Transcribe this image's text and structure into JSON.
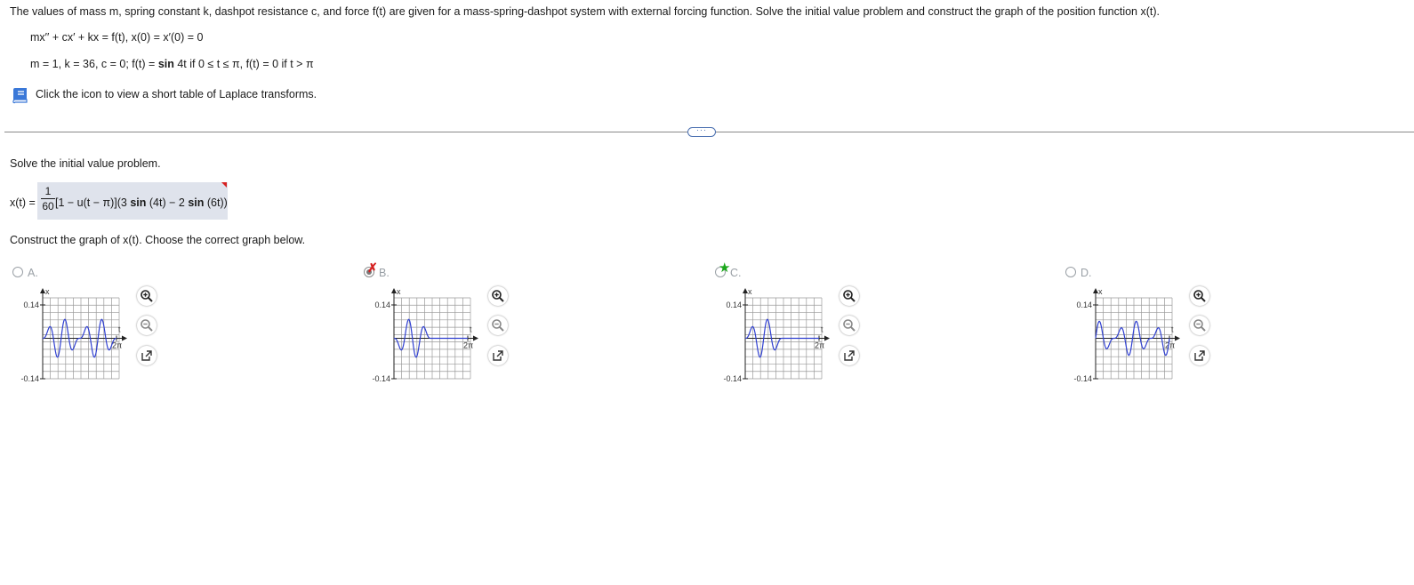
{
  "problem": {
    "statement": "The values of mass m, spring constant k, dashpot resistance c, and force f(t) are given for a mass-spring-dashpot system with external forcing function. Solve the initial value problem and construct the graph of the position function x(t).",
    "equation": "mx′′ + cx′ + kx = f(t), x(0) = x′(0) = 0",
    "params_prefix": "m = 1, k = 36, c = 0; f(t) = ",
    "params_bold": "sin",
    "params_suffix": " 4t if 0 ≤ t ≤ π, f(t) = 0 if t > π",
    "laplace_link": "Click the icon to view a short table of Laplace transforms.",
    "book_icon": "book-icon"
  },
  "more_button": "···",
  "part1": {
    "prompt": "Solve the initial value problem.",
    "lhs": "x(t) =",
    "frac_num": "1",
    "frac_den": "60",
    "body_a": "[1 − u(t − π)](3 ",
    "bold_sin1": "sin",
    "body_b": " (4t) − 2 ",
    "bold_sin2": "sin",
    "body_c": " (6t))",
    "status_color": "#d62020"
  },
  "part2": {
    "prompt": "Construct the graph of x(t). Choose the correct graph below."
  },
  "choices": [
    {
      "label": "A.",
      "selected": false,
      "mark": "",
      "x_axis_label": "x",
      "t_axis_label": "t",
      "y_max_label": "0.14",
      "y_min_label": "-0.14",
      "t_tick_label": "2π",
      "shape": "full-sum",
      "zoom_in_icon": "zoom-in-icon",
      "zoom_out_icon": "zoom-out-icon",
      "popout_icon": "popout-icon"
    },
    {
      "label": "B.",
      "selected": true,
      "mark": "✗",
      "x_axis_label": "x",
      "t_axis_label": "t",
      "y_max_label": "0.14",
      "y_min_label": "-0.14",
      "t_tick_label": "2π",
      "shape": "negated-truncated",
      "zoom_in_icon": "zoom-in-icon",
      "zoom_out_icon": "zoom-out-icon",
      "popout_icon": "popout-icon"
    },
    {
      "label": "C.",
      "selected": false,
      "mark": "★",
      "x_axis_label": "x",
      "t_axis_label": "t",
      "y_max_label": "0.14",
      "y_min_label": "-0.14",
      "t_tick_label": "2π",
      "shape": "truncated",
      "zoom_in_icon": "zoom-in-icon",
      "zoom_out_icon": "zoom-out-icon",
      "popout_icon": "popout-icon"
    },
    {
      "label": "D.",
      "selected": false,
      "mark": "",
      "x_axis_label": "x",
      "t_axis_label": "t",
      "y_max_label": "0.14",
      "y_min_label": "-0.14",
      "t_tick_label": "2π",
      "shape": "full-sum-alt",
      "zoom_in_icon": "zoom-in-icon",
      "zoom_out_icon": "zoom-out-icon",
      "popout_icon": "popout-icon"
    }
  ],
  "colors": {
    "curve": "#2f3fd0",
    "grid": "#9a9a9a",
    "accent": "#4a6fb0",
    "correct": "#1ca81c",
    "wrong": "#d62020"
  }
}
